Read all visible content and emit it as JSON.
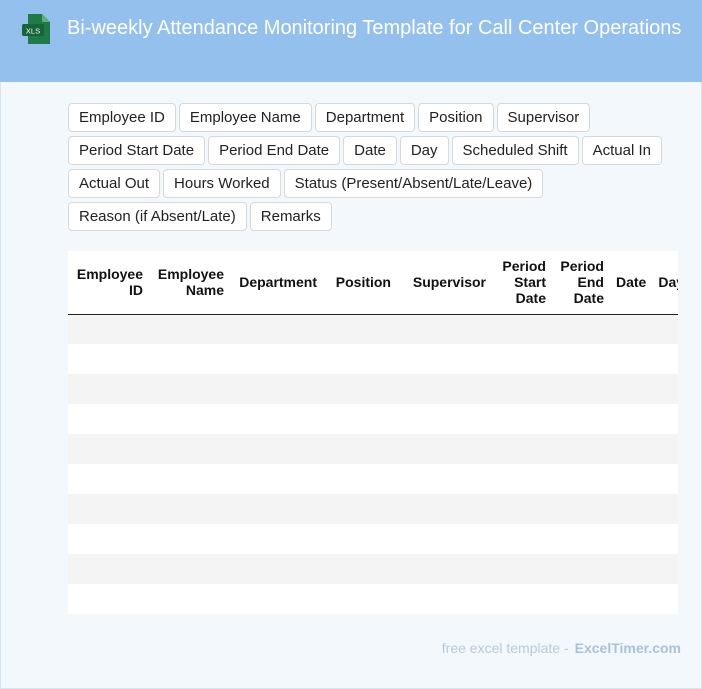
{
  "header": {
    "icon_label": "XLS",
    "title": "Bi-weekly Attendance Monitoring Template for Call Center Operations"
  },
  "fields": [
    "Employee ID",
    "Employee Name",
    "Department",
    "Position",
    "Supervisor",
    "Period Start Date",
    "Period End Date",
    "Date",
    "Day",
    "Scheduled Shift",
    "Actual In",
    "Actual Out",
    "Hours Worked",
    "Status (Present/Absent/Late/Leave)",
    "Reason (if Absent/Late)",
    "Remarks"
  ],
  "table": {
    "columns": [
      {
        "line1": "Employee",
        "line2": "ID"
      },
      {
        "line1": "Employee",
        "line2": "Name"
      },
      {
        "line1": "Department"
      },
      {
        "line1": "Position"
      },
      {
        "line1": "Supervisor"
      },
      {
        "line1": "Period",
        "line2": "Start",
        "line3": "Date"
      },
      {
        "line1": "Period",
        "line2": "End",
        "line3": "Date"
      },
      {
        "line1": "Date"
      },
      {
        "line1": "Day"
      }
    ]
  },
  "footer": {
    "prefix": "free excel template -",
    "brand": "ExcelTimer.com"
  },
  "colors": {
    "header_bg": "#93c0ec",
    "page_bg": "#f3f8fd",
    "icon_green": "#1e7b45"
  }
}
